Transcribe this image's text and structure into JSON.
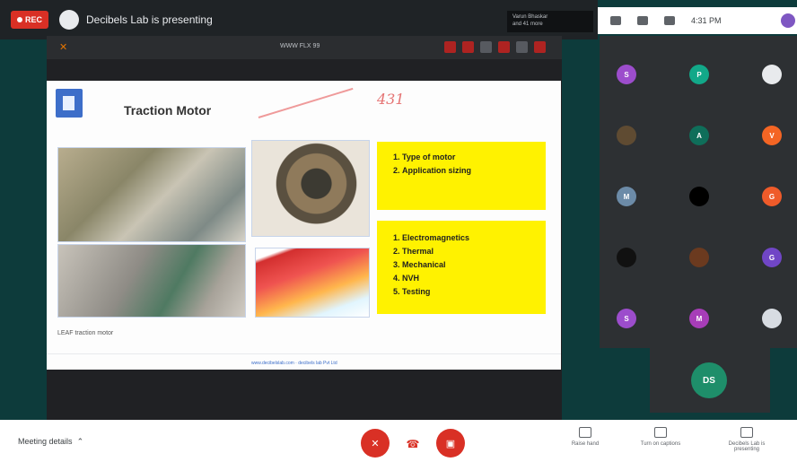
{
  "topbar": {
    "rec_label": "REC",
    "presenting_text": "Decibels Lab is presenting",
    "viewer_name": "Varun Bhaskar\nand 41 more"
  },
  "sysbar": {
    "time": "4:31 PM"
  },
  "slide_toolbar": {
    "close_glyph": "✕",
    "zoom_label": "WWW FLX 99"
  },
  "slide": {
    "title": "Traction Motor",
    "annotation": "431",
    "caption": "LEAF traction motor",
    "callout_top": [
      "Type of motor",
      "Application sizing"
    ],
    "callout_bottom": [
      "Electromagnetics",
      "Thermal",
      "Mechanical",
      "NVH",
      "Testing"
    ],
    "footer": "www.decibelslab.com · decibels lab Pvt Ltd"
  },
  "participants": [
    {
      "initial": "S",
      "color": "#9c4dcc"
    },
    {
      "initial": "P",
      "color": "#12a889"
    },
    {
      "initial": "",
      "color": "#e8eaed"
    },
    {
      "initial": "",
      "color": "#5f4b32"
    },
    {
      "initial": "A",
      "color": "#0f6e5a"
    },
    {
      "initial": "V",
      "color": "#f46524"
    },
    {
      "initial": "M",
      "color": "#6c8ba8"
    },
    {
      "initial": "",
      "color": "#000000"
    },
    {
      "initial": "G",
      "color": "#ef5b2a"
    },
    {
      "initial": "",
      "color": "#111111"
    },
    {
      "initial": "",
      "color": "#6b3a1f"
    },
    {
      "initial": "G",
      "color": "#7046c6"
    },
    {
      "initial": "S",
      "color": "#9c4dcc"
    },
    {
      "initial": "M",
      "color": "#a73db8"
    },
    {
      "initial": "",
      "color": "#d7dce2"
    }
  ],
  "self_tile": {
    "initial": "DS",
    "color": "#1e8e6a"
  },
  "bottombar": {
    "meeting_details": "Meeting details",
    "raise_hand": "Raise hand",
    "captions": "Turn on captions",
    "present": "Decibels Lab is presenting"
  }
}
